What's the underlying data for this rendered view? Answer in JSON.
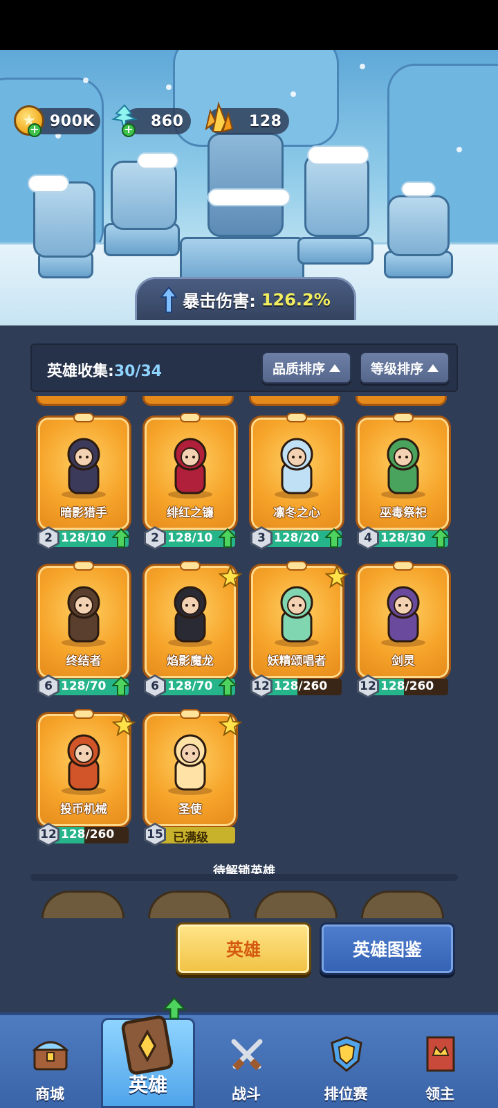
{
  "currencies": [
    {
      "name": "gold",
      "value": "900K"
    },
    {
      "name": "diamond",
      "value": "860"
    },
    {
      "name": "crystal",
      "value": "128"
    }
  ],
  "crit_banner": {
    "label": "暴击伤害:",
    "value": "126.2%"
  },
  "collection": {
    "label": "英雄收集:",
    "count": "30/34",
    "sort_quality": "品质排序",
    "sort_level": "等级排序"
  },
  "heroes": [
    {
      "name": "暗影猎手",
      "level": "2",
      "progress": "128/10",
      "fill": 1.0,
      "upgradable": true,
      "starred": false,
      "color": "#3b3a5a"
    },
    {
      "name": "绯红之镰",
      "level": "2",
      "progress": "128/10",
      "fill": 1.0,
      "upgradable": true,
      "starred": false,
      "color": "#b0203a"
    },
    {
      "name": "凛冬之心",
      "level": "3",
      "progress": "128/20",
      "fill": 1.0,
      "upgradable": true,
      "starred": false,
      "color": "#bfe0f5"
    },
    {
      "name": "巫毒祭祀",
      "level": "4",
      "progress": "128/30",
      "fill": 1.0,
      "upgradable": true,
      "starred": false,
      "color": "#4aa35c"
    },
    {
      "name": "终结者",
      "level": "6",
      "progress": "128/70",
      "fill": 1.0,
      "upgradable": true,
      "starred": false,
      "color": "#5a3e2e"
    },
    {
      "name": "焰影魔龙",
      "level": "6",
      "progress": "128/70",
      "fill": 1.0,
      "upgradable": true,
      "starred": true,
      "color": "#2a2a34"
    },
    {
      "name": "妖精颂唱者",
      "level": "12",
      "progress": "128/260",
      "fill": 0.49,
      "upgradable": false,
      "starred": true,
      "color": "#7fd6b0"
    },
    {
      "name": "剑灵",
      "level": "12",
      "progress": "128/260",
      "fill": 0.49,
      "upgradable": false,
      "starred": false,
      "color": "#6a4a9c"
    },
    {
      "name": "投币机械",
      "level": "12",
      "progress": "128/260",
      "fill": 0.49,
      "upgradable": false,
      "starred": true,
      "color": "#d2552a"
    },
    {
      "name": "圣使",
      "level": "15",
      "progress": "已满级",
      "fill": 1.0,
      "upgradable": false,
      "starred": true,
      "maxed": true,
      "color": "#ffe3a6"
    }
  ],
  "locked_label": "待解锁英雄",
  "actions": {
    "heroes": "英雄",
    "codex": "英雄图鉴"
  },
  "nav": [
    {
      "label": "商城",
      "icon": "chest-icon"
    },
    {
      "label": "英雄",
      "icon": "hero-card-icon",
      "active": true
    },
    {
      "label": "战斗",
      "icon": "crossed-swords-icon"
    },
    {
      "label": "排位赛",
      "icon": "rank-shield-icon"
    },
    {
      "label": "领主",
      "icon": "banner-crown-icon"
    }
  ]
}
